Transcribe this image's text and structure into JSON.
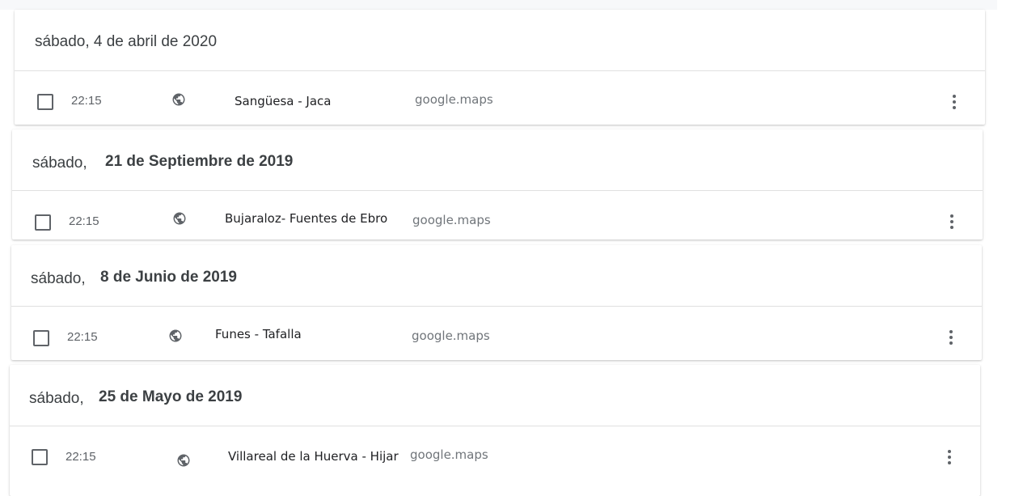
{
  "entries": [
    {
      "date_prefix": "sábado, 4 de abril de 2020",
      "date_bold": "",
      "time": "22:15",
      "title": "Sangüesa - Jaca",
      "source": "google.maps"
    },
    {
      "date_prefix": "sábado,",
      "date_bold": "21 de Septiembre  de 2019",
      "time": "22:15",
      "title": "Bujaraloz- Fuentes de Ebro",
      "source": "google.maps"
    },
    {
      "date_prefix": "sábado,",
      "date_bold": "8 de Junio de 2019",
      "time": "22:15",
      "title": "Funes - Tafalla",
      "source": "google.maps"
    },
    {
      "date_prefix": "sábado,",
      "date_bold": "25 de Mayo de 2019",
      "time": "22:15",
      "title": "Villareal de la Huerva - Hijar",
      "source": "google.maps"
    }
  ],
  "icons": {
    "row_icon": "globe-icon",
    "checkbox": "checkbox-icon",
    "menu": "more-vert-icon"
  },
  "colors": {
    "text": "#3c4043",
    "muted": "#5f6368",
    "source": "#70757a",
    "divider": "#e0e0e0"
  }
}
